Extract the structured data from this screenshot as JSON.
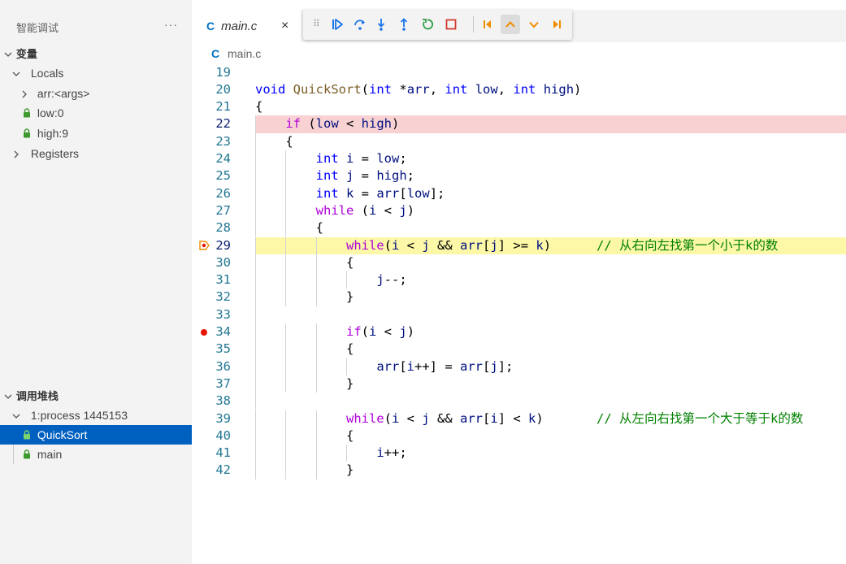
{
  "sidebar": {
    "header": "智能调试",
    "more": "···",
    "variables_title": "变量",
    "locals_label": "Locals",
    "vars": [
      {
        "label": "arr:<args>",
        "expandable": true,
        "locked": false
      },
      {
        "label": "low:0",
        "expandable": false,
        "locked": true
      },
      {
        "label": "high:9",
        "expandable": false,
        "locked": true
      }
    ],
    "registers_label": "Registers",
    "callstack_title": "调用堆栈",
    "process_label": "1:process 1445153",
    "frames": [
      {
        "label": "QuickSort",
        "selected": true
      },
      {
        "label": "main",
        "selected": false
      }
    ]
  },
  "tab": {
    "lang_icon": "C",
    "name": "main.c",
    "close": "×"
  },
  "breadcrumb": {
    "lang_icon": "C",
    "file": "main.c"
  },
  "debug_toolbar": {
    "buttons": [
      {
        "name": "continue-icon",
        "color": "#1a73e8"
      },
      {
        "name": "step-over-icon",
        "color": "#1a73e8"
      },
      {
        "name": "step-into-icon",
        "color": "#1a73e8"
      },
      {
        "name": "step-out-icon",
        "color": "#1a73e8"
      },
      {
        "name": "restart-icon",
        "color": "#2e9e44"
      },
      {
        "name": "stop-icon",
        "color": "#d13b2e"
      },
      {
        "name": "go-to-top-icon",
        "color": "#f08c00"
      },
      {
        "name": "step-back-icon",
        "color": "#f08c00"
      },
      {
        "name": "step-down-icon",
        "color": "#f08c00"
      },
      {
        "name": "go-to-end-icon",
        "color": "#f08c00"
      }
    ]
  },
  "code": {
    "lines": [
      {
        "n": "19",
        "text": ""
      },
      {
        "n": "20",
        "text": "void QuickSort(int *arr, int low, int high)"
      },
      {
        "n": "21",
        "text": "{"
      },
      {
        "n": "22",
        "text": "    if (low < high)"
      },
      {
        "n": "23",
        "text": "    {"
      },
      {
        "n": "24",
        "text": "        int i = low;"
      },
      {
        "n": "25",
        "text": "        int j = high;"
      },
      {
        "n": "26",
        "text": "        int k = arr[low];"
      },
      {
        "n": "27",
        "text": "        while (i < j)"
      },
      {
        "n": "28",
        "text": "        {"
      },
      {
        "n": "29",
        "text": "            while(i < j && arr[j] >= k)      // 从右向左找第一个小于k的数"
      },
      {
        "n": "30",
        "text": "            {"
      },
      {
        "n": "31",
        "text": "                j--;"
      },
      {
        "n": "32",
        "text": "            }"
      },
      {
        "n": "33",
        "text": ""
      },
      {
        "n": "34",
        "text": "            if(i < j)"
      },
      {
        "n": "35",
        "text": "            {"
      },
      {
        "n": "36",
        "text": "                arr[i++] = arr[j];"
      },
      {
        "n": "37",
        "text": "            }"
      },
      {
        "n": "38",
        "text": ""
      },
      {
        "n": "39",
        "text": "            while(i < j && arr[i] < k)       // 从左向右找第一个大于等于k的数"
      },
      {
        "n": "40",
        "text": "            {"
      },
      {
        "n": "41",
        "text": "                i++;"
      },
      {
        "n": "42",
        "text": "            }"
      }
    ],
    "breakpoint_error_line": "22",
    "current_line": "29",
    "breakpoint_line": "34"
  },
  "colors": {
    "selected_frame_bg": "#0060c0",
    "error_line_bg": "#f8d2d2",
    "current_line_bg": "#fcf8a7",
    "breakpoint": "#e51400",
    "lock": "#3c9a2c"
  }
}
